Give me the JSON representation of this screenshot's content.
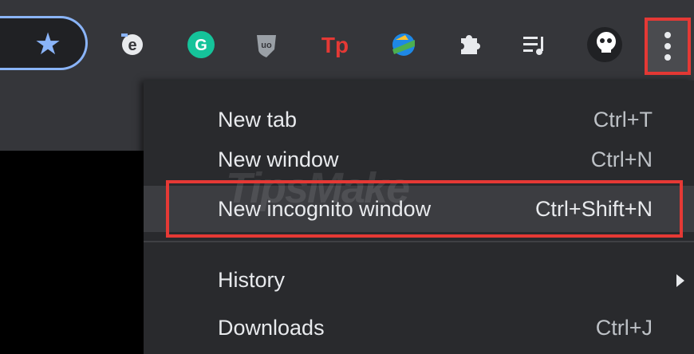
{
  "toolbar": {
    "bookmark_icon": "star-icon",
    "extensions": [
      {
        "name": "ie-tab-extension-icon",
        "color": "#ffffff"
      },
      {
        "name": "grammarly-extension-icon",
        "color": "#15c39a"
      },
      {
        "name": "ublock-origin-extension-icon",
        "color": "#9aa0a6"
      },
      {
        "name": "tp-extension-icon",
        "color": "#e53935"
      },
      {
        "name": "idm-extension-icon",
        "color": "#4caf50"
      },
      {
        "name": "extensions-puzzle-icon",
        "color": "#e8eaed"
      },
      {
        "name": "media-control-icon",
        "color": "#e8eaed"
      },
      {
        "name": "profile-avatar-icon",
        "color": "#ffffff"
      }
    ],
    "menu_button_icon": "three-dots-icon"
  },
  "menu": {
    "items": [
      {
        "label": "New tab",
        "shortcut": "Ctrl+T"
      },
      {
        "label": "New window",
        "shortcut": "Ctrl+N"
      },
      {
        "label": "New incognito window",
        "shortcut": "Ctrl+Shift+N"
      },
      {
        "label": "History",
        "shortcut": ""
      },
      {
        "label": "Downloads",
        "shortcut": "Ctrl+J"
      }
    ]
  },
  "watermark": "TipsMake",
  "colors": {
    "highlight_border": "#e53935",
    "accent_blue": "#8ab4f8"
  }
}
